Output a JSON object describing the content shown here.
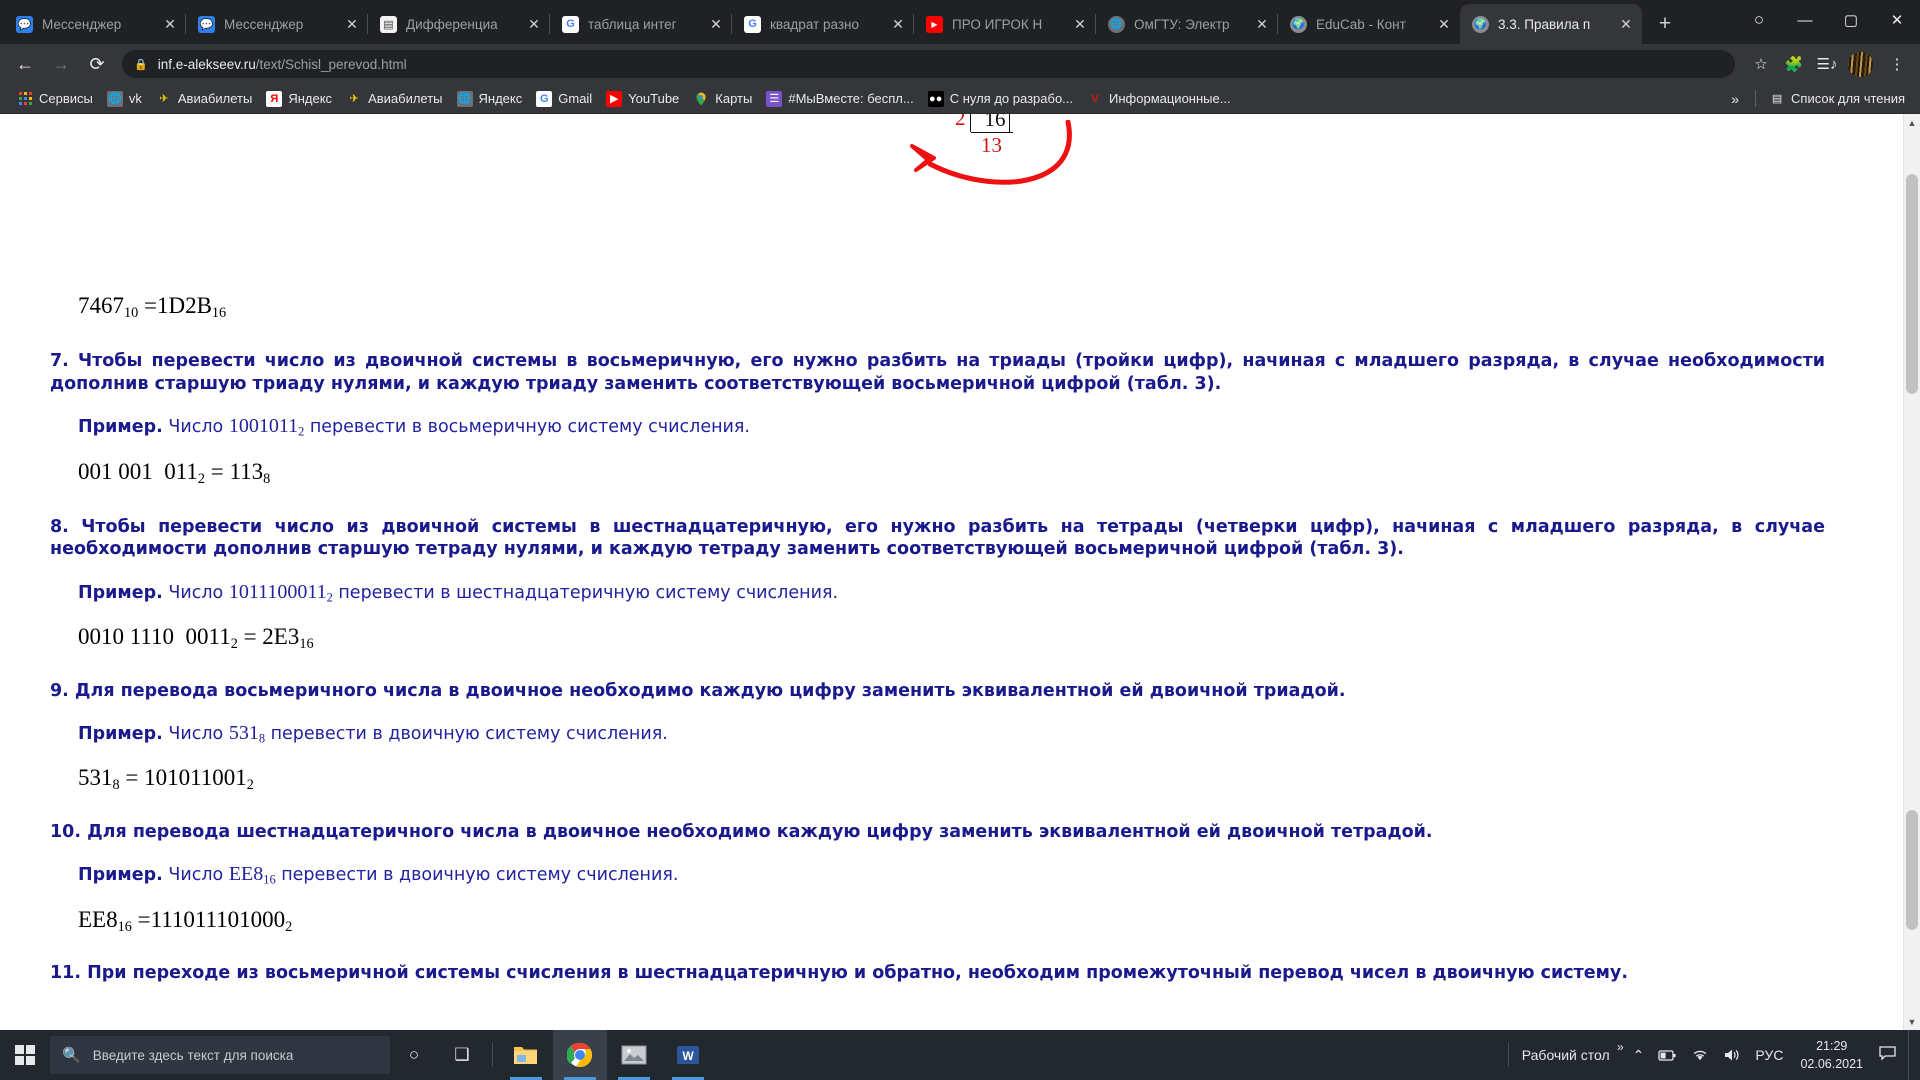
{
  "browser": {
    "tabs": [
      {
        "title": "Мессенджер",
        "favicon": "messenger-icon",
        "active": false
      },
      {
        "title": "Мессенджер",
        "favicon": "messenger-icon",
        "active": false
      },
      {
        "title": "Дифференциа",
        "favicon": "document-icon",
        "active": false
      },
      {
        "title": "таблица интег",
        "favicon": "google-icon",
        "active": false
      },
      {
        "title": "квадрат разно",
        "favicon": "google-icon",
        "active": false
      },
      {
        "title": "ПРО ИГРОК Н",
        "favicon": "youtube-icon",
        "active": false
      },
      {
        "title": "ОмГТУ: Электр",
        "favicon": "globe-icon",
        "active": false
      },
      {
        "title": "EduCab - Конт",
        "favicon": "earth-icon",
        "active": false
      },
      {
        "title": "3.3. Правила п",
        "favicon": "earth-icon",
        "active": true
      }
    ],
    "new_tab_label": "+",
    "window_controls": {
      "account": "○",
      "minimize": "—",
      "maximize": "▢",
      "close": "✕"
    },
    "nav": {
      "back": "←",
      "forward": "→",
      "reload": "⟳"
    },
    "omnibox": {
      "lock_icon": "lock-icon",
      "url_host": "inf.e-alekseev.ru",
      "url_path": "/text/Schisl_perevod.html"
    },
    "toolbar_icons": {
      "bookmark_star": "☆",
      "extensions": "puzzle-icon",
      "media": "media-icon",
      "profile": "avatar",
      "menu": "⋮"
    },
    "bookmarks": [
      {
        "label": "Сервисы",
        "icon": "apps-grid-icon"
      },
      {
        "label": "vk",
        "icon": "globe-icon"
      },
      {
        "label": "Авиабилеты",
        "icon": "plane-icon"
      },
      {
        "label": "Яндекс",
        "icon": "yandex-icon"
      },
      {
        "label": "Авиабилеты",
        "icon": "plane-icon"
      },
      {
        "label": "Яндекс",
        "icon": "globe-icon"
      },
      {
        "label": "Gmail",
        "icon": "google-icon"
      },
      {
        "label": "YouTube",
        "icon": "youtube-icon"
      },
      {
        "label": "Карты",
        "icon": "maps-pin-icon"
      },
      {
        "label": "#МыВместе: беспл...",
        "icon": "keep-icon"
      },
      {
        "label": "С нуля до разрабо...",
        "icon": "black-icon"
      },
      {
        "label": "Информационные...",
        "icon": "v-icon"
      }
    ],
    "bookmarks_overflow": "»",
    "reading_list": {
      "label": "Список для чтения",
      "icon": "reading-list-icon"
    }
  },
  "content": {
    "division_snippet": {
      "divisor": "2",
      "dividend": "16",
      "remainder": "13"
    },
    "blocks": [
      {
        "kind": "formula",
        "html": "7467<sub>10</sub> =1D2B<sub>16</sub>"
      },
      {
        "kind": "rule",
        "text": "7. Чтобы перевести число из двоичной системы в восьмеричную, его нужно разбить на триады (тройки цифр), начиная с младшего разряда, в случае необходимости дополнив старшую триаду нулями, и каждую триаду заменить соответствующей восьмеричной цифрой (табл. 3)."
      },
      {
        "kind": "example",
        "label": "Пример.",
        "pre": " Число ",
        "inline_math": "1001011<sub>2</sub>",
        "post": " перевести в восьмеричную систему счисления."
      },
      {
        "kind": "formula",
        "html": "001 001  011<sub>2</sub> = 113<sub>8</sub>"
      },
      {
        "kind": "rule",
        "text": "8. Чтобы перевести число из двоичной системы в шестнадцатеричную, его нужно разбить на тетрады (четверки цифр), начиная с младшего разряда, в случае необходимости дополнив старшую тетраду нулями, и каждую тетраду заменить соответствующей восьмеричной цифрой (табл. 3)."
      },
      {
        "kind": "example",
        "label": "Пример.",
        "pre": " Число ",
        "inline_math": "1011100011<sub>2</sub>",
        "post": "  перевести в шестнадцатеричную систему счисления."
      },
      {
        "kind": "formula",
        "html": "0010 1110  0011<sub>2</sub> = 2E3<sub>16</sub>"
      },
      {
        "kind": "rule",
        "text": "9. Для перевода восьмеричного числа в двоичное необходимо каждую цифру заменить эквивалентной ей двоичной триадой."
      },
      {
        "kind": "example",
        "label": "Пример.",
        "pre": " Число ",
        "inline_math": "531<sub>8</sub>",
        "post": "  перевести в двоичную систему счисления."
      },
      {
        "kind": "formula",
        "html": "531<sub>8</sub> = 101011001<sub>2</sub>"
      },
      {
        "kind": "rule",
        "text": "10. Для перевода шестнадцатеричного числа в двоичное необходимо каждую цифру заменить эквивалентной ей двоичной тетрадой."
      },
      {
        "kind": "example",
        "label": "Пример.",
        "pre": " Число ",
        "inline_math": "EE8<sub>16</sub>",
        "post": "  перевести в двоичную систему счисления."
      },
      {
        "kind": "formula",
        "html": "EE8<sub>16</sub> =111011101000<sub>2</sub>"
      },
      {
        "kind": "rule",
        "text": "11. При переходе из восьмеричной системы счисления в шестнадцатеричную и обратно, необходим промежуточный перевод чисел в двоичную систему."
      }
    ]
  },
  "taskbar": {
    "start_label": "start-button",
    "search_placeholder": "Введите здесь текст для поиска",
    "buttons": [
      {
        "name": "cortana-button",
        "glyph": "○"
      },
      {
        "name": "task-view-button",
        "glyph": "❑"
      }
    ],
    "apps": [
      {
        "name": "file-explorer",
        "glyph": "📁",
        "open": true,
        "active": false
      },
      {
        "name": "google-chrome",
        "glyph": "chrome",
        "open": true,
        "active": true
      },
      {
        "name": "photo-viewer",
        "glyph": "🖼",
        "open": true,
        "active": false
      },
      {
        "name": "microsoft-word",
        "glyph": "W",
        "open": true,
        "active": false
      }
    ],
    "tray": {
      "desktop_label": "Рабочий стол",
      "overflow": "»",
      "chevron": "⌃",
      "battery": "battery-icon",
      "wifi": "wifi-icon",
      "volume": "volume-icon",
      "language": "РУС",
      "time": "21:29",
      "date": "02.06.2021",
      "notifications": "notification-icon"
    }
  },
  "colors": {
    "chrome_dark": "#202124",
    "toolbar": "#35363a",
    "text_navy": "#1a1a8c",
    "text_blue": "#2222a0",
    "arrow_red": "#cf1313",
    "taskbar": "#23272e",
    "accent_blue": "#4a9ae0"
  }
}
